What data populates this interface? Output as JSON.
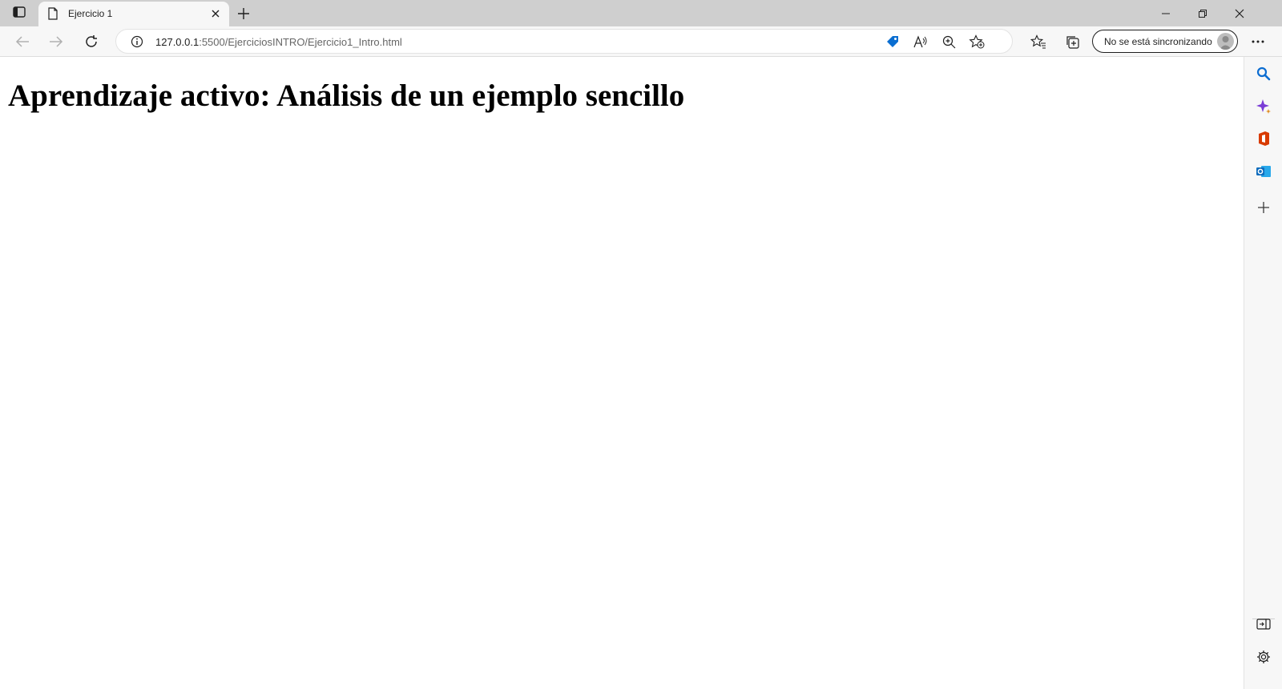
{
  "tab": {
    "title": "Ejercicio 1"
  },
  "address_bar": {
    "url_host": "127.0.0.1",
    "url_path": ":5500/EjerciciosINTRO/Ejercicio1_Intro.html"
  },
  "profile": {
    "sync_label": "No se está sincronizando"
  },
  "page": {
    "heading": "Aprendizaje activo: Análisis de un ejemplo sencillo"
  },
  "icons": {
    "tab_actions": "tab-actions-icon",
    "favicon": "document-icon",
    "close_tab": "close-icon",
    "new_tab": "plus-icon",
    "minimize": "minimize-icon",
    "restore": "restore-icon",
    "close_window": "close-icon",
    "back": "arrow-left-icon",
    "forward": "arrow-right-icon",
    "refresh": "refresh-icon",
    "site_info": "info-icon",
    "shopping": "tag-icon",
    "read_aloud": "read-aloud-icon",
    "zoom": "zoom-icon",
    "add_favorite": "star-plus-icon",
    "favorites": "favorites-icon",
    "collections": "collections-icon",
    "more": "more-icon",
    "sidebar_search": "search-icon",
    "sidebar_copilot": "copilot-icon",
    "sidebar_office": "office-icon",
    "sidebar_outlook": "outlook-icon",
    "sidebar_add": "plus-icon",
    "sidebar_hide": "hide-sidebar-icon",
    "sidebar_settings": "gear-icon"
  },
  "colors": {
    "tab_strip": "#cfcfcf",
    "toolbar": "#f7f7f7",
    "shopping_tag": "#0a6ed1",
    "search_icon": "#0c6dd1",
    "office_red": "#d83b01",
    "outlook_blue": "#0f6cbd"
  }
}
